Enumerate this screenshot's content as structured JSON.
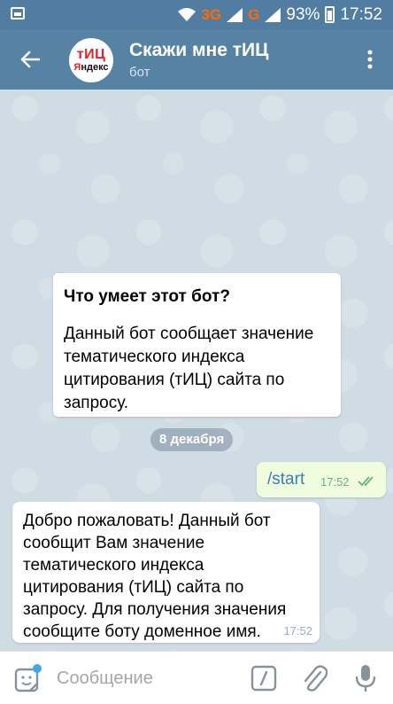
{
  "status_bar": {
    "network_3g": "3G",
    "network_g": "G",
    "battery": "93%",
    "time": "17:52"
  },
  "header": {
    "title": "Скажи мне тИЦ",
    "subtitle": "бот",
    "avatar_line1": "тИЦ",
    "avatar_line2_red": "Я",
    "avatar_line2_black": "ндекс"
  },
  "bot_info": {
    "title": "Что умеет этот бот?",
    "text": "Данный бот сообщает значение тематического индекса цитирования (тИЦ) сайта по запросу."
  },
  "date_divider": "8 декабря",
  "messages": [
    {
      "direction": "out",
      "text": "/start",
      "time": "17:52",
      "status": "read"
    },
    {
      "direction": "in",
      "text": "Добро пожаловать! Данный бот сообщит Вам значение тематического индекса цитирования (тИЦ) сайта по запросу. Для получения значения сообщите боту доменное имя.",
      "time": "17:52"
    }
  ],
  "composer": {
    "placeholder": "Сообщение"
  },
  "colors": {
    "header": "#5682a3",
    "status_bar": "#517da2",
    "outgoing_bubble": "#effdde",
    "link": "#3a7eb8",
    "check": "#6cb174",
    "accent_dot": "#3ea9f0"
  },
  "icons": {
    "back": "arrow-left-icon",
    "menu": "more-vertical-icon",
    "sticker": "sticker-icon",
    "command": "slash-command-icon",
    "attach": "paperclip-icon",
    "mic": "microphone-icon",
    "check": "double-check-icon"
  }
}
